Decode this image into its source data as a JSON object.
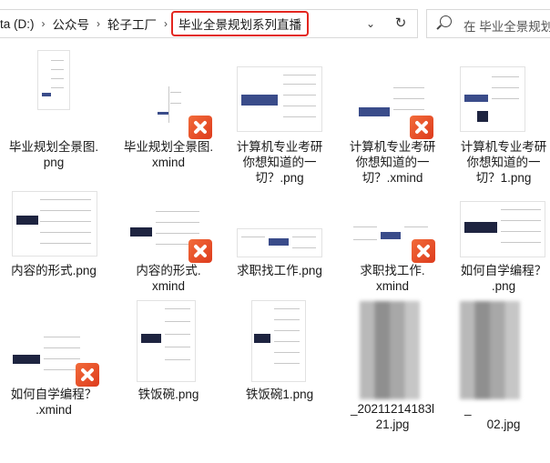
{
  "address_bar": {
    "crumbs": [
      "ta (D:)",
      "公众号",
      "轮子工厂"
    ],
    "current": "毕业全景规划系列直播"
  },
  "search": {
    "placeholder": "在 毕业全景规划..."
  },
  "files": [
    {
      "name": "毕业规划全景图.png",
      "type": "png"
    },
    {
      "name": "毕业规划全景图.xmind",
      "type": "xmind"
    },
    {
      "name": "计算机专业考研你想知道的一切？.png",
      "type": "png"
    },
    {
      "name": "计算机专业考研你想知道的一切？.xmind",
      "type": "xmind"
    },
    {
      "name": "计算机专业考研你想知道的一切？1.png",
      "type": "png"
    },
    {
      "name": "内容的形式.png",
      "type": "png"
    },
    {
      "name": "内容的形式.xmind",
      "type": "xmind"
    },
    {
      "name": "求职找工作.png",
      "type": "png"
    },
    {
      "name": "求职找工作.xmind",
      "type": "xmind"
    },
    {
      "name": "如何自学编程？.png",
      "type": "png"
    },
    {
      "name": "如何自学编程？.xmind",
      "type": "xmind"
    },
    {
      "name": "铁饭碗.png",
      "type": "png"
    },
    {
      "name": "铁饭碗1.png",
      "type": "png"
    },
    {
      "name": "_20211214183121.jpg",
      "type": "jpg"
    },
    {
      "name": "_2...02.jpg",
      "type": "jpg"
    }
  ],
  "labels": {
    "f0": [
      "毕业规划全景图.",
      "png"
    ],
    "f1": [
      "毕业规划全景图.",
      "xmind"
    ],
    "f2": [
      "计算机专业考研",
      "你想知道的一",
      "切？.png"
    ],
    "f3": [
      "计算机专业考研",
      "你想知道的一",
      "切？.xmind"
    ],
    "f4": [
      "计算机专业考研",
      "你想知道的一",
      "切？1.png"
    ],
    "f5": [
      "内容的形式.png"
    ],
    "f6": [
      "内容的形式.",
      "xmind"
    ],
    "f7": [
      "求职找工作.png"
    ],
    "f8": [
      "求职找工作.",
      "xmind"
    ],
    "f9": [
      "如何自学编程？",
      ".png"
    ],
    "f10": [
      "如何自学编程？",
      ".xmind"
    ],
    "f11": [
      "铁饭碗.png"
    ],
    "f12": [
      "铁饭碗1.png"
    ],
    "f13": [
      "_20211214183l",
      "21.jpg"
    ],
    "f14": [
      "_",
      "02.jpg"
    ]
  },
  "colors": {
    "highlight": "#e3261f",
    "xmind_badge": "#e8502a"
  }
}
